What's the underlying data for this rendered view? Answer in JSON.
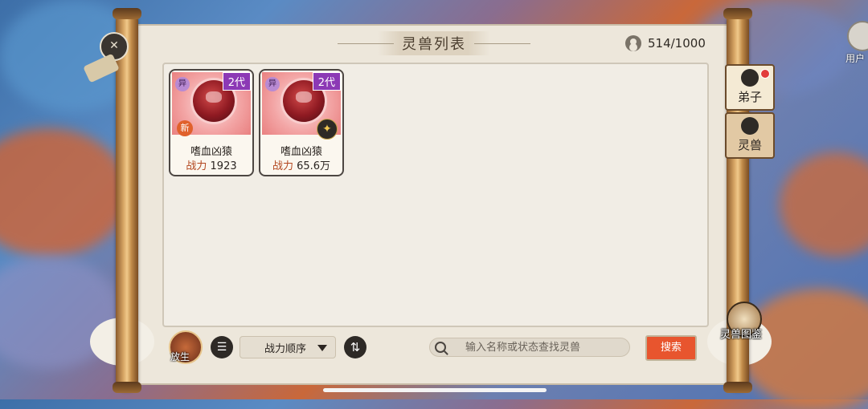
{
  "header": {
    "title": "灵兽列表",
    "capacity": "514/1000"
  },
  "cards": [
    {
      "generation": "2代",
      "variant": "异",
      "badge": "新",
      "name": "嗜血凶猿",
      "power_label": "战力",
      "power_value": "1923"
    },
    {
      "generation": "2代",
      "variant": "异",
      "name": "嗜血凶猿",
      "power_label": "战力",
      "power_value": "65.6万"
    }
  ],
  "side_tabs": [
    {
      "label": "弟子",
      "notification": true
    },
    {
      "label": "灵兽",
      "notification": false
    }
  ],
  "codex_label": "灵兽图鉴",
  "user_label": "用户",
  "bottom_bar": {
    "release_label": "放生",
    "sort_value": "战力顺序",
    "search_placeholder": "输入名称或状态查找灵兽",
    "search_button": "搜索"
  },
  "colors": {
    "accent_orange": "#e8552e",
    "generation_purple": "#8c39b5",
    "power_label": "#b2461e"
  }
}
